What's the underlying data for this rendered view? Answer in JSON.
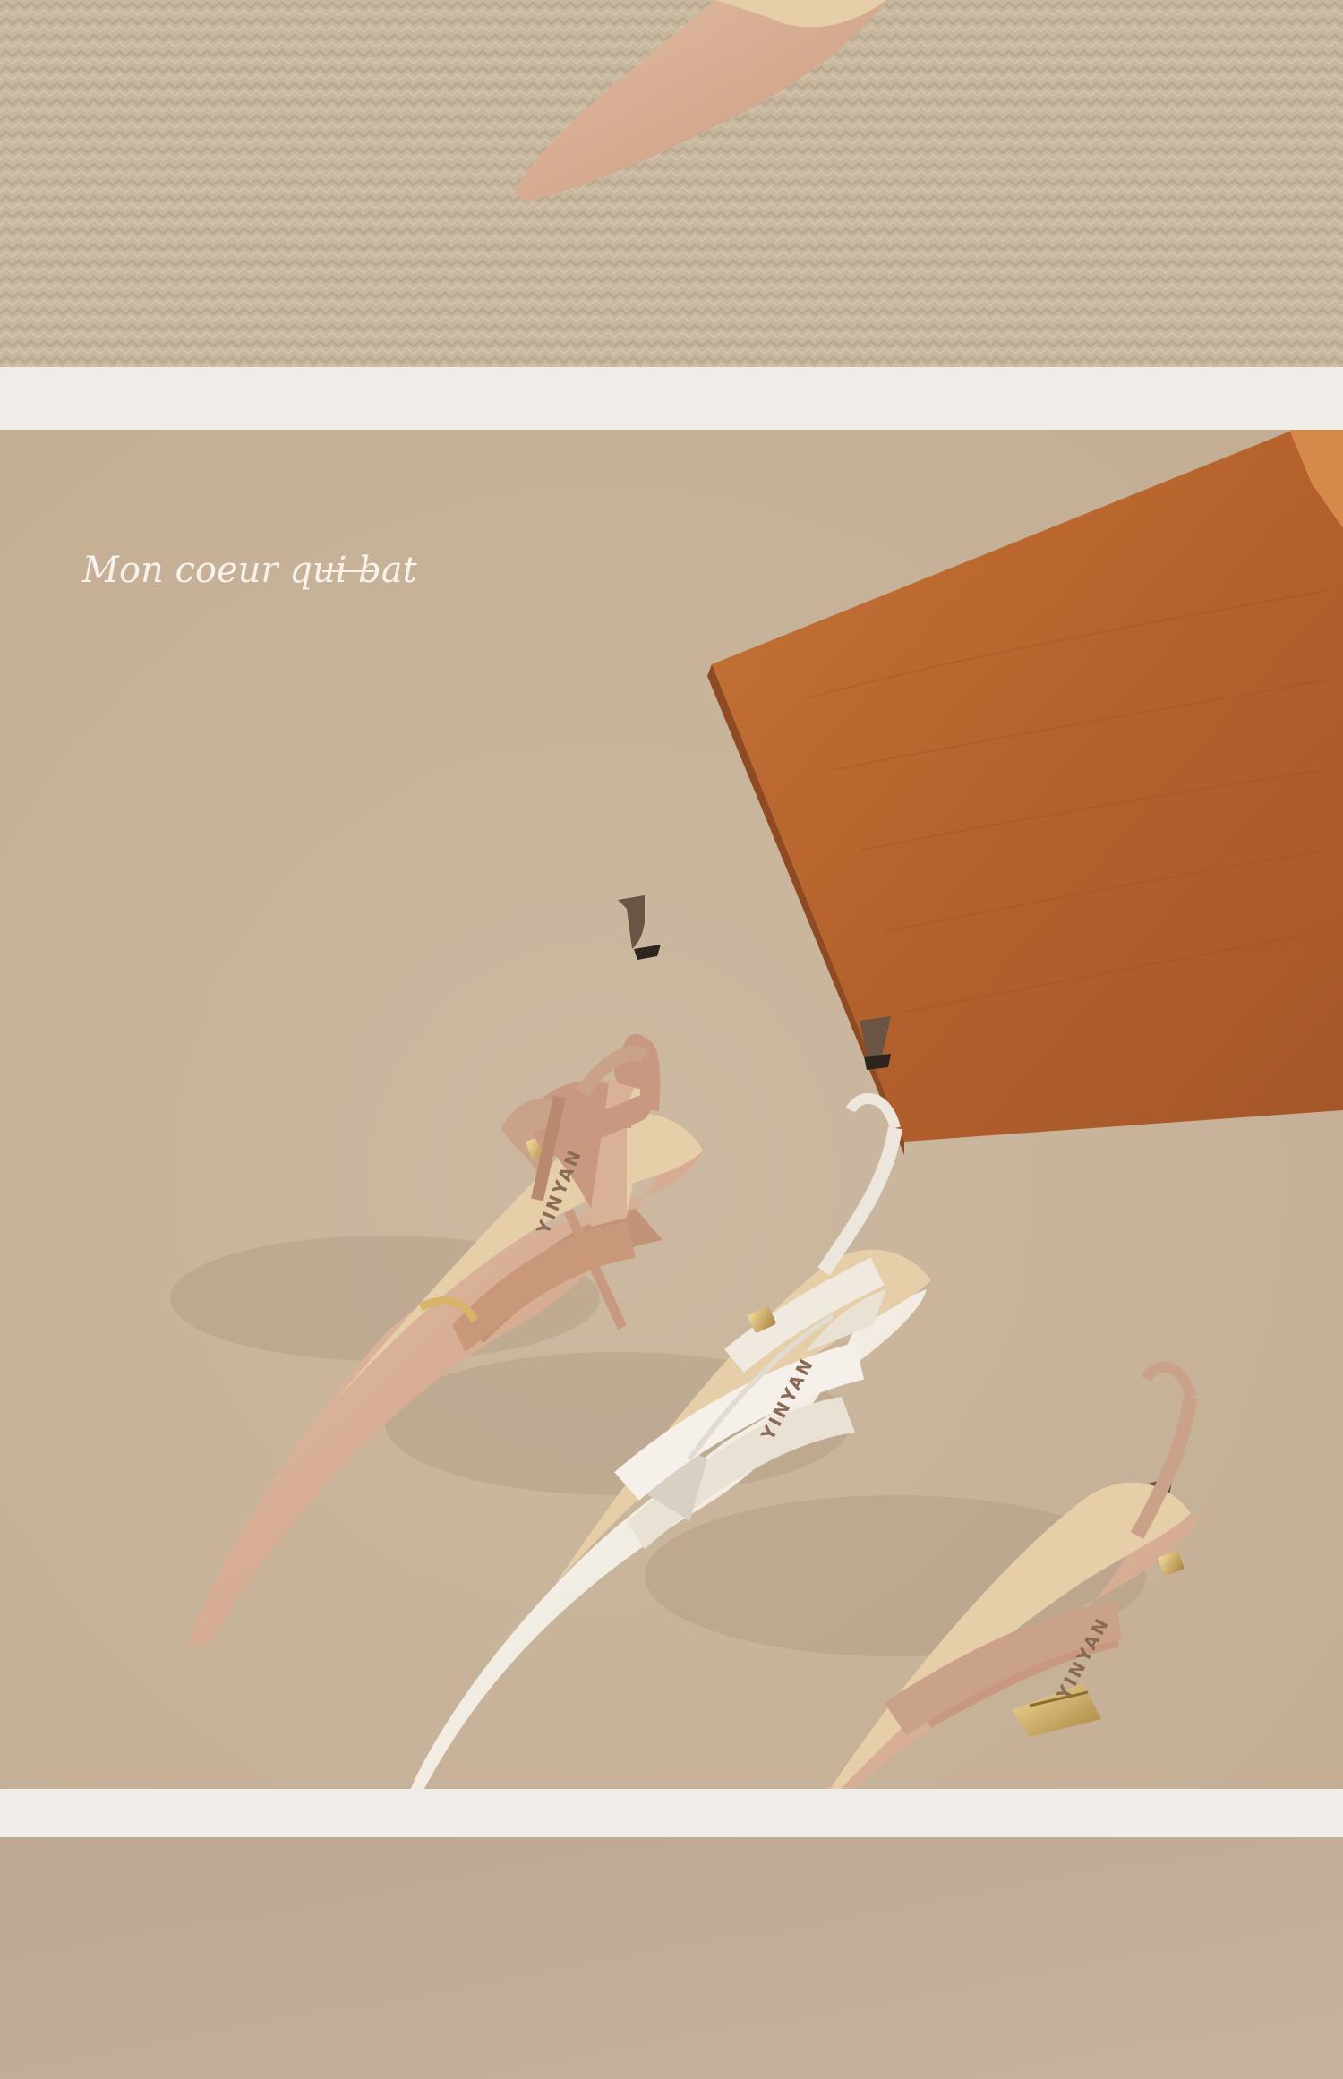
{
  "photo": {
    "tagline": "Mon coeur qui bat",
    "insole_brand": "YINYAN",
    "colors": {
      "gap": "#f0ede9",
      "rug": "#c9b8a0",
      "backdrop": "#c9b59d",
      "board": "#b8642e",
      "nude": "#d3a88c",
      "cream": "#f3eee5",
      "insole": "#e6cfa8",
      "gold": "#d8b46a"
    }
  }
}
